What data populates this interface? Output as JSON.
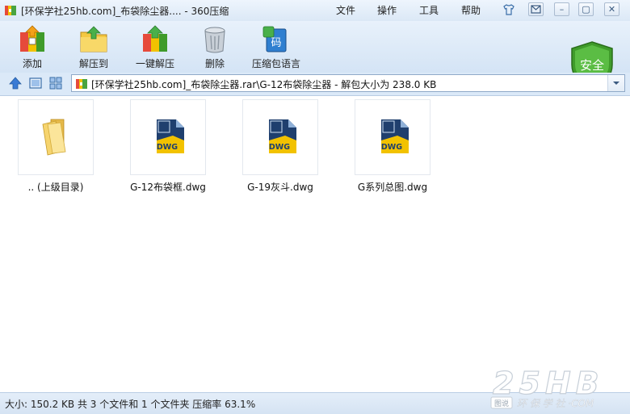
{
  "window": {
    "title": "[环保学社25hb.com]_布袋除尘器.... - 360压缩",
    "menus": [
      "文件",
      "操作",
      "工具",
      "帮助"
    ],
    "controls": {
      "skin_icon": "tshirt-icon",
      "msg_icon": "message-icon",
      "min": "–",
      "max": "▢",
      "close": "✕"
    }
  },
  "toolbar": {
    "items": [
      {
        "label": "添加",
        "icon": "add-archive-icon"
      },
      {
        "label": "解压到",
        "icon": "extract-to-icon"
      },
      {
        "label": "一键解压",
        "icon": "one-click-extract-icon"
      },
      {
        "label": "删除",
        "icon": "trash-icon"
      },
      {
        "label": "压缩包语言",
        "icon": "archive-language-icon"
      }
    ],
    "security_badge": "安全"
  },
  "address": {
    "path": "[环保学社25hb.com]_布袋除尘器.rar\\G-12布袋除尘器 - 解包大小为 238.0 KB"
  },
  "files": [
    {
      "name": ".. (上级目录)",
      "type": "folder"
    },
    {
      "name": "G-12布袋框.dwg",
      "type": "dwg",
      "badge": "DWG"
    },
    {
      "name": "G-19灰斗.dwg",
      "type": "dwg",
      "badge": "DWG"
    },
    {
      "name": "G系列总图.dwg",
      "type": "dwg",
      "badge": "DWG"
    }
  ],
  "status": {
    "text": "大小: 150.2 KB 共 3 个文件和 1 个文件夹 压缩率 63.1%"
  },
  "watermark": {
    "main": "25HB",
    "sub": "环 保 学 社 ·COM",
    "seal": "图说"
  },
  "colors": {
    "accent": "#3a7bd5",
    "shield_green": "#3f9b2a",
    "dwg_yellow": "#f2c200",
    "dwg_navy": "#1f3f6e"
  }
}
